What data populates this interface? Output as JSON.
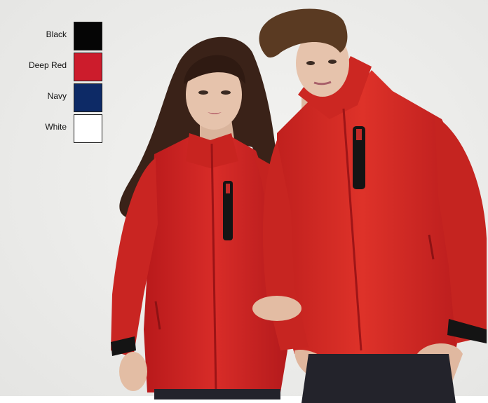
{
  "swatches": [
    {
      "label": "Black",
      "color": "#050505"
    },
    {
      "label": "Deep Red",
      "color": "#cc1c2c"
    },
    {
      "label": "Navy",
      "color": "#0d2a66"
    },
    {
      "label": "White",
      "color": "#ffffff"
    }
  ],
  "colors": {
    "backdrop": "#eeeeec",
    "jacket_red": "#d22a26",
    "jacket_shadow": "#a5161a",
    "trim_black": "#141414",
    "hair_dark": "#3a2218",
    "hair_brown": "#5a3a22",
    "skin": "#e6c3ac",
    "jeans": "#23232b"
  }
}
